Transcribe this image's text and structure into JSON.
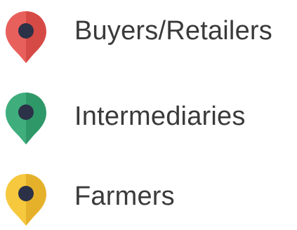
{
  "legend": {
    "items": [
      {
        "label": "Buyers/Retailers",
        "icon": "map-pin-icon",
        "color_light": "#e8605c",
        "color_dark": "#d64a46",
        "dot_color": "#2b3147"
      },
      {
        "label": "Intermediaries",
        "icon": "map-pin-icon",
        "color_light": "#3fae7c",
        "color_dark": "#2f9869",
        "dot_color": "#2b3147"
      },
      {
        "label": "Farmers",
        "icon": "map-pin-icon",
        "color_light": "#f6c83e",
        "color_dark": "#e6b12a",
        "dot_color": "#2b3147"
      }
    ]
  }
}
